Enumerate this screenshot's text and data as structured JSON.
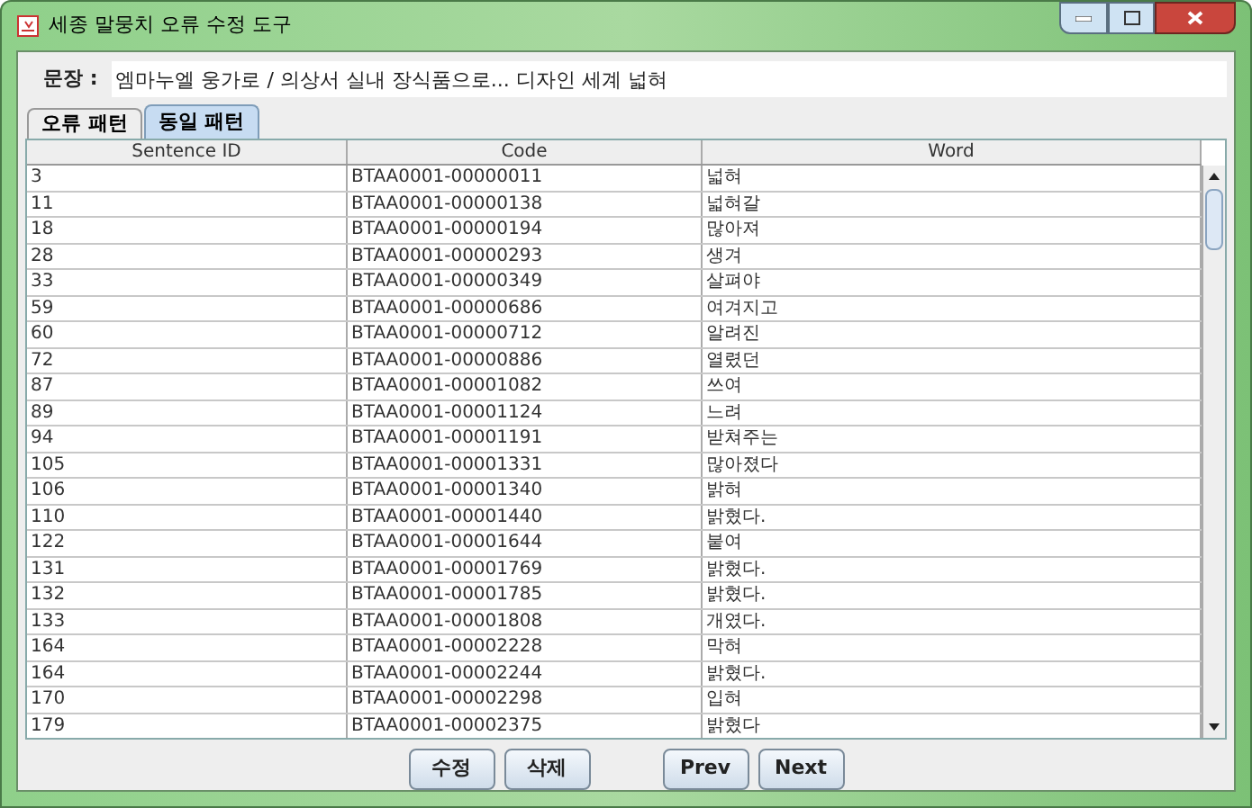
{
  "window": {
    "title": "세종 말뭉치 오류 수정 도구"
  },
  "sentence": {
    "label": "문장 :",
    "value": "엠마누엘 웅가로 / 의상서 실내 장식품으로... 디자인 세계 넓혀"
  },
  "tabs": [
    {
      "label": "오류 패턴",
      "selected": false
    },
    {
      "label": "동일 패턴",
      "selected": true
    }
  ],
  "table": {
    "columns": [
      "Sentence ID",
      "Code",
      "Word"
    ],
    "rows": [
      [
        "3",
        "BTAA0001-00000011",
        "넓혀"
      ],
      [
        "11",
        "BTAA0001-00000138",
        "넓혀갈"
      ],
      [
        "18",
        "BTAA0001-00000194",
        "많아져"
      ],
      [
        "28",
        "BTAA0001-00000293",
        "생겨"
      ],
      [
        "33",
        "BTAA0001-00000349",
        "살펴야"
      ],
      [
        "59",
        "BTAA0001-00000686",
        "여겨지고"
      ],
      [
        "60",
        "BTAA0001-00000712",
        "알려진"
      ],
      [
        "72",
        "BTAA0001-00000886",
        "열렸던"
      ],
      [
        "87",
        "BTAA0001-00001082",
        "쓰여"
      ],
      [
        "89",
        "BTAA0001-00001124",
        "느려"
      ],
      [
        "94",
        "BTAA0001-00001191",
        "받쳐주는"
      ],
      [
        "105",
        "BTAA0001-00001331",
        "많아졌다"
      ],
      [
        "106",
        "BTAA0001-00001340",
        "밝혀"
      ],
      [
        "110",
        "BTAA0001-00001440",
        "밝혔다."
      ],
      [
        "122",
        "BTAA0001-00001644",
        "붙여"
      ],
      [
        "131",
        "BTAA0001-00001769",
        "밝혔다."
      ],
      [
        "132",
        "BTAA0001-00001785",
        "밝혔다."
      ],
      [
        "133",
        "BTAA0001-00001808",
        "개였다."
      ],
      [
        "164",
        "BTAA0001-00002228",
        "막혀"
      ],
      [
        "164",
        "BTAA0001-00002244",
        "밝혔다."
      ],
      [
        "170",
        "BTAA0001-00002298",
        "입혀"
      ],
      [
        "179",
        "BTAA0001-00002375",
        "밝혔다"
      ]
    ]
  },
  "button_groups": [
    [
      "수정",
      "삭제"
    ],
    [
      "Prev",
      "Next"
    ]
  ]
}
